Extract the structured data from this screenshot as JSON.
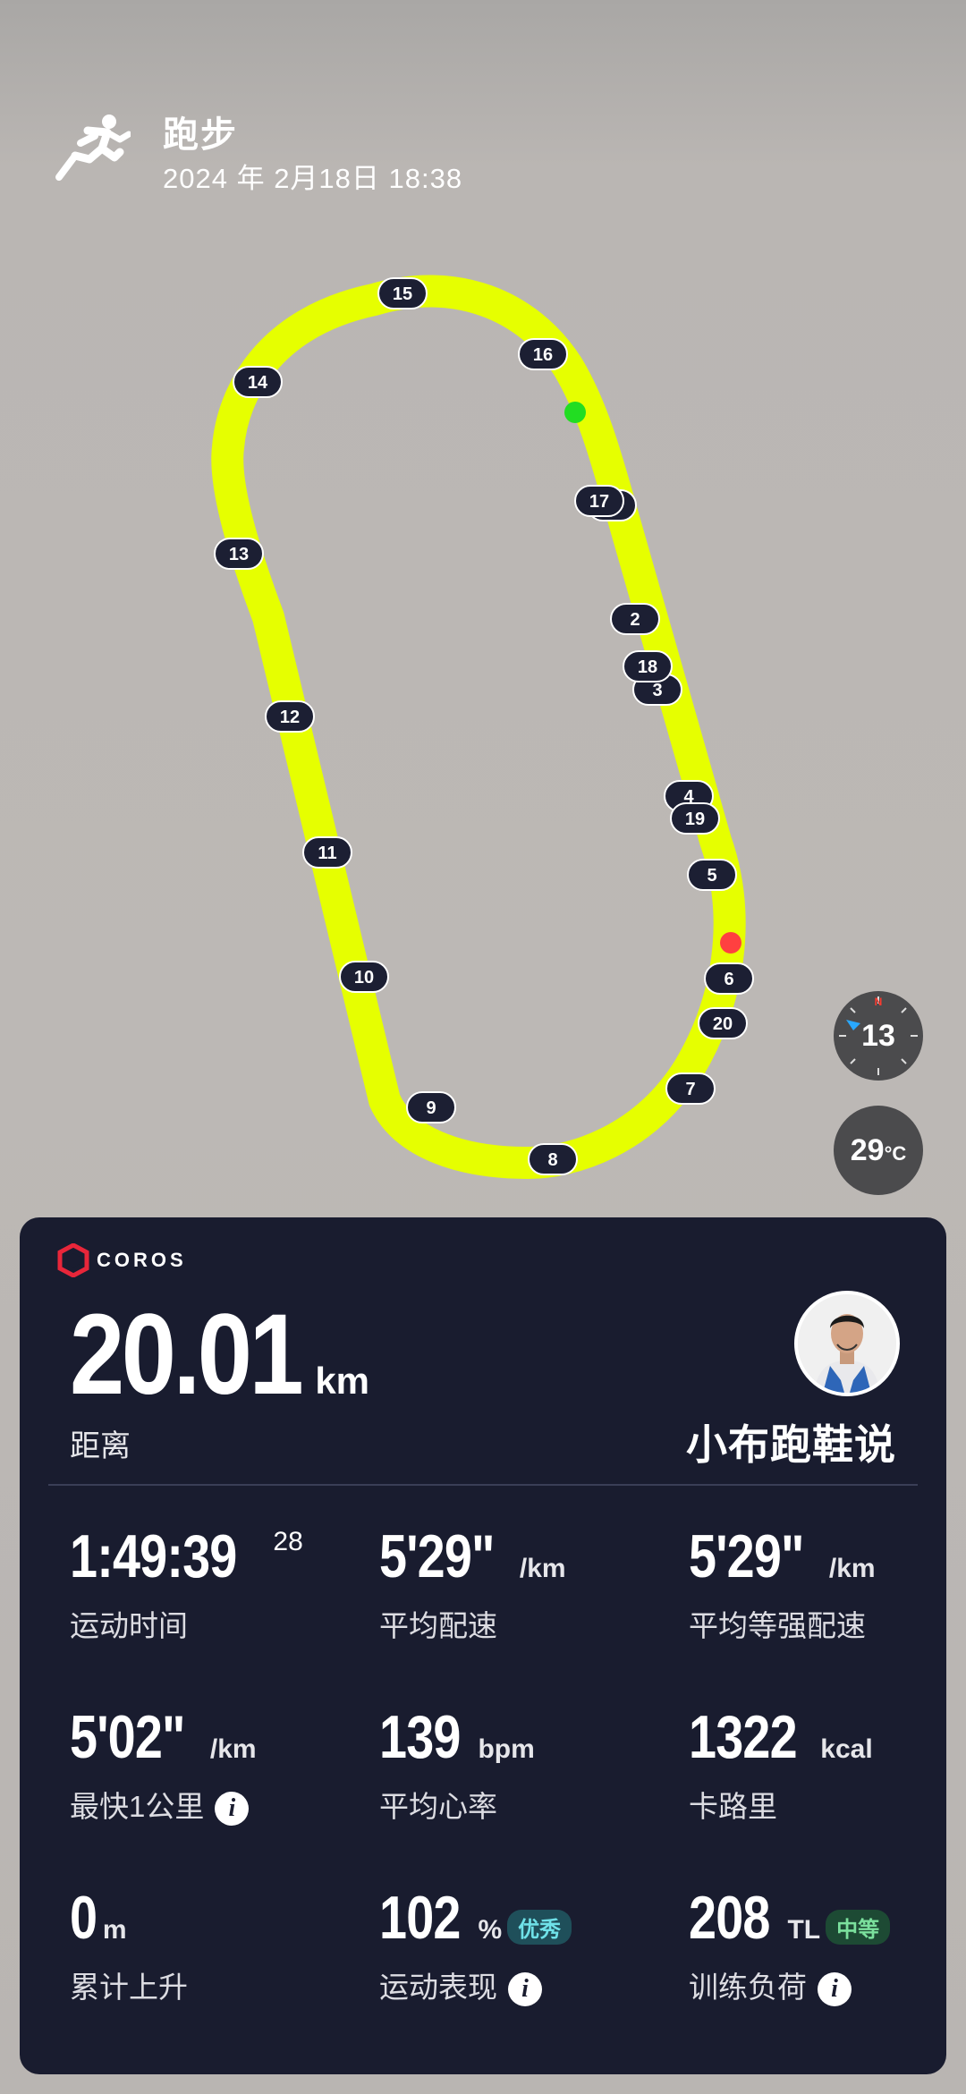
{
  "header": {
    "title": "跑步",
    "datetime": "2024 年 2月18日 18:38",
    "icon": "running-person-icon"
  },
  "map": {
    "route_color": "#e6ff00",
    "start_color": "#22dd22",
    "end_color": "#ff4040",
    "km_markers": [
      "2",
      "3",
      "4",
      "5",
      "6",
      "7",
      "8",
      "9",
      "10",
      "11",
      "12",
      "13",
      "14",
      "15",
      "16",
      "17",
      "18",
      "19",
      "20"
    ]
  },
  "compass": {
    "value": "13",
    "icon": "compass-icon"
  },
  "temperature": {
    "value": "29",
    "unit": "°C"
  },
  "card": {
    "brand": "COROS",
    "distance": {
      "value": "20.01",
      "unit": "km",
      "label": "距离"
    },
    "username": "小布跑鞋说",
    "stats": [
      {
        "value": "1:49:39",
        "sup": "28",
        "unit": "",
        "label": "运动时间"
      },
      {
        "value": "5'29\"",
        "unit": "/km",
        "label": "平均配速"
      },
      {
        "value": "5'29\"",
        "unit": "/km",
        "label": "平均等强配速"
      },
      {
        "value": "5'02\"",
        "unit": "/km",
        "label": "最快1公里",
        "info": "i"
      },
      {
        "value": "139",
        "unit": "bpm",
        "label": "平均心率"
      },
      {
        "value": "1322",
        "unit": "kcal",
        "label": "卡路里"
      },
      {
        "value": "0",
        "unit": "m",
        "label": "累计上升"
      },
      {
        "value": "102",
        "unit": "%",
        "badge": "优秀",
        "label": "运动表现",
        "info": "i"
      },
      {
        "value": "208",
        "unit": "TL",
        "badge": "中等",
        "label": "训练负荷",
        "info": "i"
      }
    ]
  }
}
